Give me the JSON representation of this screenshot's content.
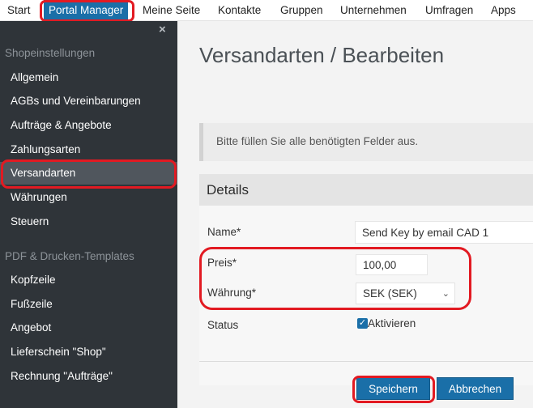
{
  "topnav": {
    "items": [
      "Start",
      "Portal Manager",
      "Meine Seite",
      "Kontakte",
      "Gruppen",
      "Unternehmen",
      "Umfragen",
      "Apps"
    ]
  },
  "sidebar": {
    "close_icon": "×",
    "section1": "Shopeinstellungen",
    "items1": [
      "Allgemein",
      "AGBs und Vereinbarungen",
      "Aufträge & Angebote",
      "Zahlungsarten",
      "Versandarten",
      "Währungen",
      "Steuern"
    ],
    "section2": "PDF & Drucken-Templates",
    "items2": [
      "Kopfzeile",
      "Fußzeile",
      "Angebot",
      "Lieferschein \"Shop\"",
      "Rechnung \"Aufträge\""
    ]
  },
  "main": {
    "title": "Versandarten / Bearbeiten",
    "notice": "Bitte füllen Sie alle benötigten Felder aus.",
    "panel_title": "Details",
    "form": {
      "name_label": "Name*",
      "name_value": "Send Key by email CAD 1",
      "preis_label": "Preis*",
      "preis_value": "100,00",
      "waehrung_label": "Währung*",
      "waehrung_value": "SEK (SEK)",
      "status_label": "Status",
      "status_checkbox_label": "Aktivieren"
    },
    "buttons": {
      "save": "Speichern",
      "cancel": "Abbrechen"
    }
  },
  "colors": {
    "accent": "#1a6fa8",
    "sidebar_bg": "#2f3439",
    "highlight": "#e21a22"
  }
}
